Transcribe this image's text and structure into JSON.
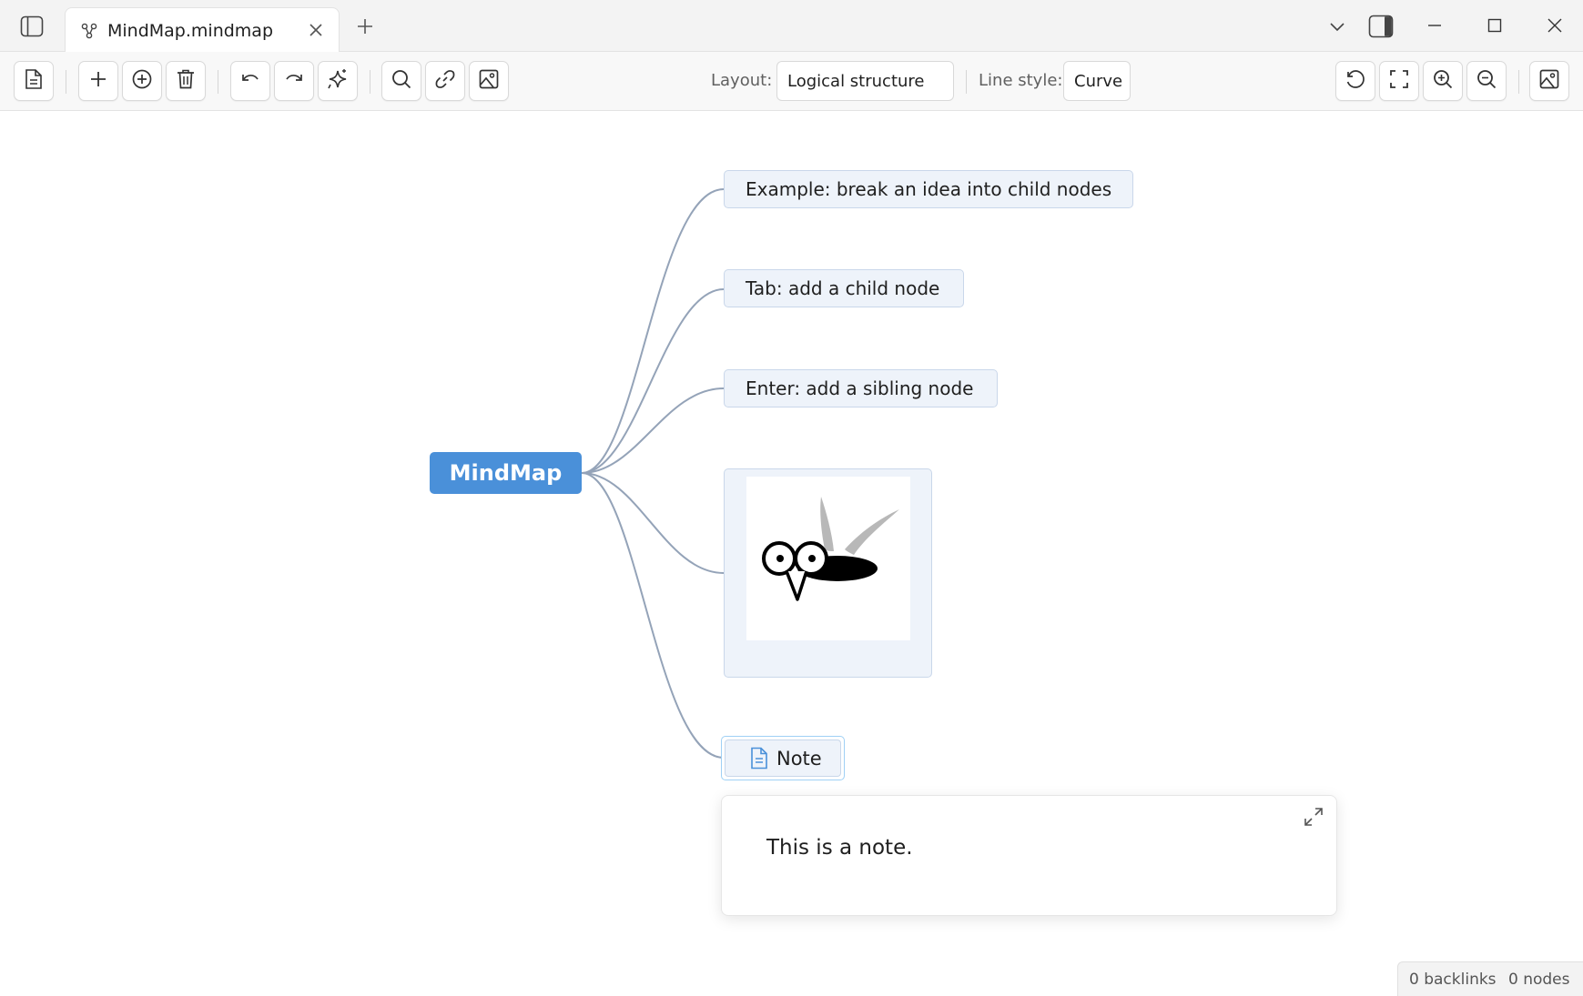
{
  "titlebar": {
    "tab_title": "MindMap.mindmap",
    "icons": {
      "sidebar": "sidebar-toggle-icon",
      "tab": "mindmap-icon",
      "close_tab": "close-icon",
      "new_tab": "plus-icon",
      "dropdown": "chevron-down-icon",
      "right_pane": "right-sidebar-icon",
      "minimize": "minimize-icon",
      "maximize": "maximize-icon",
      "close_window": "close-icon"
    }
  },
  "toolbar": {
    "layout_label": "Layout:",
    "layout_value": "Logical structure",
    "line_style_label": "Line style:",
    "line_style_value": "Curve",
    "icons": [
      "document-icon",
      "plus-icon",
      "add-circle-icon",
      "trash-icon",
      "undo-icon",
      "redo-icon",
      "sparkle-icon",
      "search-icon",
      "link-icon",
      "image-icon",
      "reset-icon",
      "fullscreen-icon",
      "zoom-in-icon",
      "zoom-out-icon",
      "export-image-icon"
    ]
  },
  "mindmap": {
    "root": "MindMap",
    "children": [
      "Example: break an idea into child nodes",
      "Tab: add a child node",
      "Enter: add a sibling node"
    ],
    "image_node": "mosquito-image",
    "note_node": "Note",
    "note_text": "This is a note.",
    "line_color": "#94a3b8",
    "root_color": "#4a90d9",
    "node_fill": "#eef3fa"
  },
  "status": {
    "backlinks": "0 backlinks",
    "nodes": "0 nodes"
  }
}
